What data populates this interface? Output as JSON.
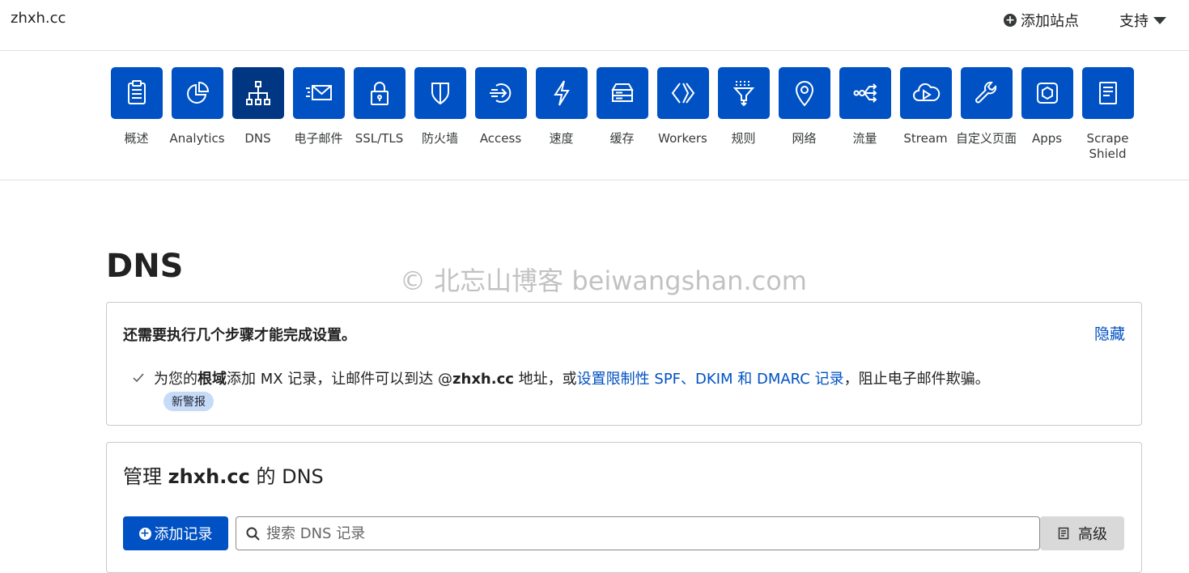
{
  "header": {
    "site_name": "zhxh.cc",
    "add_site_label": "添加站点",
    "support_label": "支持"
  },
  "nav": {
    "items": [
      {
        "label": "概述",
        "icon": "clipboard-icon"
      },
      {
        "label": "Analytics",
        "icon": "pie-chart-icon"
      },
      {
        "label": "DNS",
        "icon": "network-tree-icon",
        "active": true
      },
      {
        "label": "电子邮件",
        "icon": "envelope-icon"
      },
      {
        "label": "SSL/TLS",
        "icon": "lock-icon"
      },
      {
        "label": "防火墙",
        "icon": "shield-icon"
      },
      {
        "label": "Access",
        "icon": "sign-in-icon"
      },
      {
        "label": "速度",
        "icon": "lightning-icon"
      },
      {
        "label": "缓存",
        "icon": "server-icon"
      },
      {
        "label": "Workers",
        "icon": "code-brackets-icon"
      },
      {
        "label": "规则",
        "icon": "filter-icon"
      },
      {
        "label": "网络",
        "icon": "location-pin-icon"
      },
      {
        "label": "流量",
        "icon": "traffic-icon"
      },
      {
        "label": "Stream",
        "icon": "cloud-play-icon"
      },
      {
        "label": "自定义页面",
        "icon": "wrench-icon"
      },
      {
        "label": "Apps",
        "icon": "hexagon-icon"
      },
      {
        "label": "Scrape Shield",
        "icon": "document-icon"
      }
    ]
  },
  "watermark": "© 北忘山博客 beiwangshan.com",
  "page_title": "DNS",
  "setup_card": {
    "title": "还需要执行几个步骤才能完成设置。",
    "hide_label": "隐藏",
    "task_pre": "为您的",
    "task_bold": "根域",
    "task_mid": "添加 MX 记录，让邮件可以到达 @",
    "task_domain": "zhxh.cc",
    "task_after": " 地址，或",
    "task_link": "设置限制性 SPF、DKIM 和 DMARC 记录",
    "task_end": "，阻止电子邮件欺骗。",
    "badge": "新警报"
  },
  "manage_card": {
    "title_pre": "管理 ",
    "title_domain": "zhxh.cc",
    "title_post": " 的 DNS",
    "add_record_label": "添加记录",
    "search_placeholder": "搜索 DNS 记录",
    "advanced_label": "高级"
  },
  "colors": {
    "brand_blue": "#0051c3",
    "active_tile": "#003682",
    "link": "#0051c3",
    "badge_bg": "#c5dbf7"
  }
}
